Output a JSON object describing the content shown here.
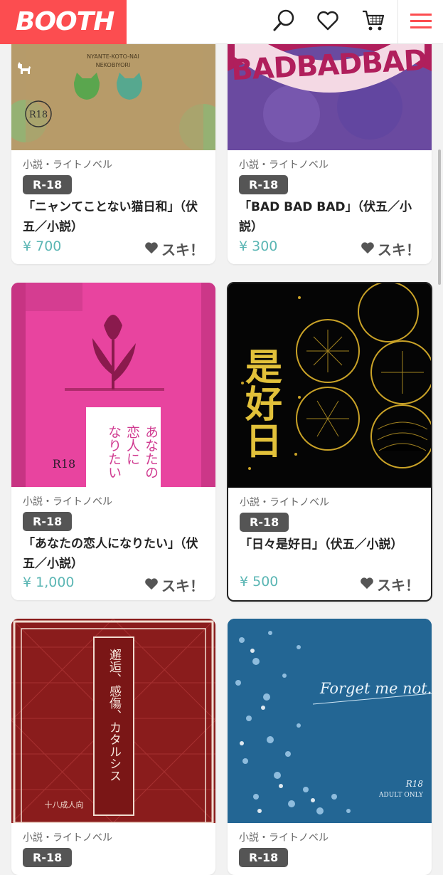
{
  "header": {
    "logo_text": "BOOTH",
    "icons": [
      "search-icon",
      "heart-icon",
      "cart-icon",
      "menu-icon"
    ],
    "brand_color": "#fc4d50"
  },
  "products": [
    {
      "category": "小説・ライトノベル",
      "badge": "R-18",
      "title": "「ニャンてことない猫日和」（伏五／小説）",
      "price": "¥ 700",
      "like_label": "スキ！",
      "cover_text": "NYANTE-KOTO-NAI\nNEKOBIYORI"
    },
    {
      "category": "小説・ライトノベル",
      "badge": "R-18",
      "title": "「BAD BAD BAD」（伏五／小説）",
      "price": "¥ 300",
      "like_label": "スキ！",
      "cover_text": "BADBADBAD"
    },
    {
      "category": "小説・ライトノベル",
      "badge": "R-18",
      "title": "「あなたの恋人になりたい」（伏五／小説）",
      "price": "¥ 1,000",
      "like_label": "スキ！",
      "cover_text": "あなたの恋人になりたい"
    },
    {
      "category": "小説・ライトノベル",
      "badge": "R-18",
      "title": "「日々是好日」（伏五／小説）",
      "price": "¥ 500",
      "like_label": "スキ！",
      "cover_text": "日々是好日"
    },
    {
      "category": "小説・ライトノベル",
      "badge": "R-18",
      "title": "",
      "price": "",
      "like_label": "",
      "cover_text": "邂逅、感傷、カタルシス"
    },
    {
      "category": "小説・ライトノベル",
      "badge": "R-18",
      "title": "",
      "price": "",
      "like_label": "",
      "cover_text": "Forget me not."
    }
  ]
}
